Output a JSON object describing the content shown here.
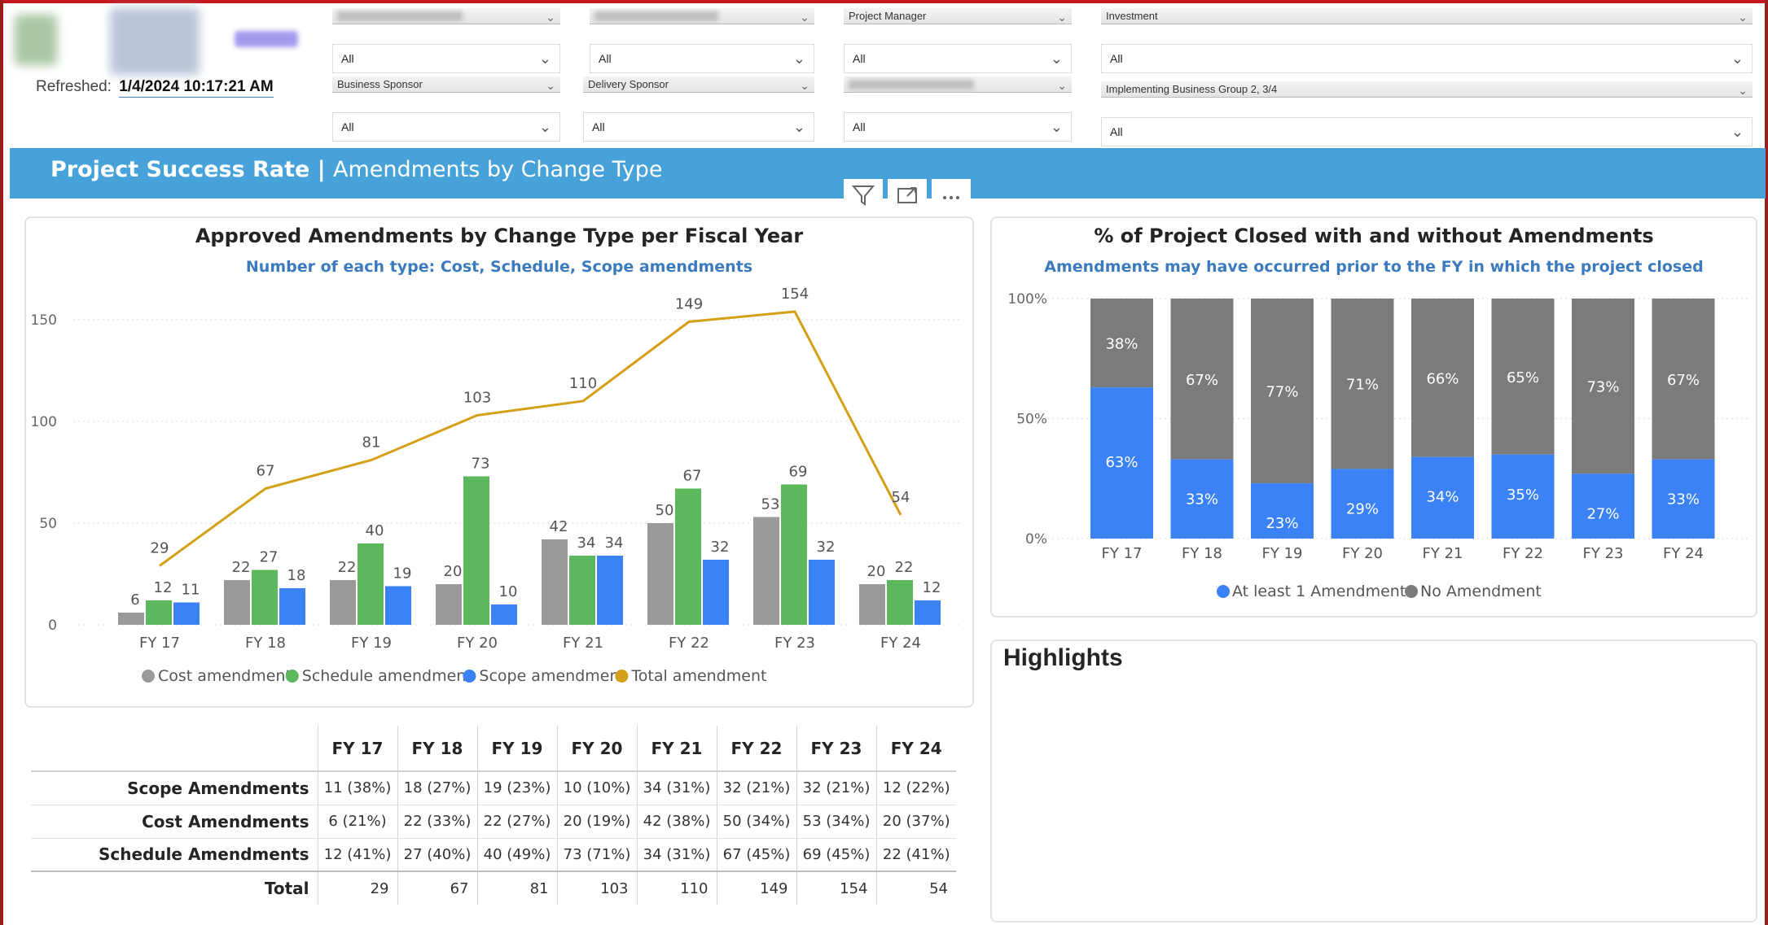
{
  "header": {
    "refreshed_label": "Refreshed:",
    "refreshed_value": "1/4/2024 10:17:21 AM"
  },
  "slicers": {
    "r1c1": {
      "title": "",
      "value": "All"
    },
    "r1c2": {
      "title": "",
      "value": "All"
    },
    "r1c3": {
      "title": "Project Manager",
      "value": "All"
    },
    "r1c4": {
      "title": "Investment",
      "value": "All"
    },
    "r2c1": {
      "title": "Business Sponsor",
      "value": "All"
    },
    "r2c2": {
      "title": "Delivery Sponsor",
      "value": "All"
    },
    "r2c3": {
      "title": "",
      "value": "All"
    },
    "r2c4": {
      "title": "Implementing Business Group 2, 3/4",
      "value": "All"
    }
  },
  "banner": {
    "title": "Project Success Rate",
    "separator": " | ",
    "subtitle": "Amendments by Change Type"
  },
  "icons": {
    "filter": "filter-icon",
    "focus": "focus-mode-icon",
    "more": "more-options-icon"
  },
  "chart_left": {
    "title": "Approved Amendments by Change Type per Fiscal Year",
    "subtitle": "Number of each type: Cost, Schedule, Scope amendments"
  },
  "chart_right": {
    "title": "% of Project Closed with and without Amendments",
    "subtitle": "Amendments may have occurred prior to the FY in which the project closed"
  },
  "highlights": {
    "title": "Highlights"
  },
  "colors": {
    "cost": "#9a9a9a",
    "schedule": "#5cb85c",
    "scope": "#3b82f6",
    "total": "#d4a017",
    "no_amendment": "#7b7b7b",
    "banner": "#46a2d8"
  },
  "chart_data": [
    {
      "type": "bar",
      "title": "Approved Amendments by Change Type per Fiscal Year",
      "subtitle": "Number of each type: Cost, Schedule, Scope amendments",
      "categories": [
        "FY 17",
        "FY 18",
        "FY 19",
        "FY 20",
        "FY 21",
        "FY 22",
        "FY 23",
        "FY 24"
      ],
      "series": [
        {
          "name": "Cost amendment",
          "type": "bar",
          "values": [
            6,
            22,
            22,
            20,
            42,
            50,
            53,
            20
          ]
        },
        {
          "name": "Schedule amendment",
          "type": "bar",
          "values": [
            12,
            27,
            40,
            73,
            34,
            67,
            69,
            22
          ]
        },
        {
          "name": "Scope amendment",
          "type": "bar",
          "values": [
            11,
            18,
            19,
            10,
            34,
            32,
            32,
            12
          ]
        },
        {
          "name": "Total amendment",
          "type": "line",
          "values": [
            29,
            67,
            81,
            103,
            110,
            149,
            154,
            54
          ]
        }
      ],
      "yticks": [
        0,
        50,
        100,
        150
      ],
      "ylim": [
        0,
        160
      ],
      "grid": true,
      "legend_position": "bottom"
    },
    {
      "type": "bar",
      "stacked": "percent",
      "title": "% of Project Closed with and without Amendments",
      "subtitle": "Amendments may have occurred prior to the FY in which the project closed",
      "categories": [
        "FY 17",
        "FY 18",
        "FY 19",
        "FY 20",
        "FY 21",
        "FY 22",
        "FY 23",
        "FY 24"
      ],
      "series": [
        {
          "name": "At least 1 Amendment",
          "values": [
            63,
            33,
            23,
            29,
            34,
            35,
            27,
            33
          ]
        },
        {
          "name": "No Amendment",
          "values": [
            38,
            67,
            77,
            71,
            66,
            65,
            73,
            67
          ]
        }
      ],
      "ytick_labels": [
        "0%",
        "50%",
        "100%"
      ],
      "grid": true,
      "legend_position": "bottom"
    }
  ],
  "table": {
    "headers": [
      "FY 17",
      "FY 18",
      "FY 19",
      "FY 20",
      "FY 21",
      "FY 22",
      "FY 23",
      "FY 24"
    ],
    "rows": [
      {
        "label": "Scope Amendments",
        "cells": [
          "11 (38%)",
          "18 (27%)",
          "19 (23%)",
          "10 (10%)",
          "34 (31%)",
          "32 (21%)",
          "32 (21%)",
          "12 (22%)"
        ]
      },
      {
        "label": "Cost Amendments",
        "cells": [
          "6 (21%)",
          "22 (33%)",
          "22 (27%)",
          "20 (19%)",
          "42 (38%)",
          "50 (34%)",
          "53 (34%)",
          "20 (37%)"
        ]
      },
      {
        "label": "Schedule Amendments",
        "cells": [
          "12 (41%)",
          "27 (40%)",
          "40 (49%)",
          "73 (71%)",
          "34 (31%)",
          "67 (45%)",
          "69 (45%)",
          "22 (41%)"
        ]
      },
      {
        "label": "Total",
        "cells": [
          "29",
          "67",
          "81",
          "103",
          "110",
          "149",
          "154",
          "54"
        ]
      }
    ]
  }
}
